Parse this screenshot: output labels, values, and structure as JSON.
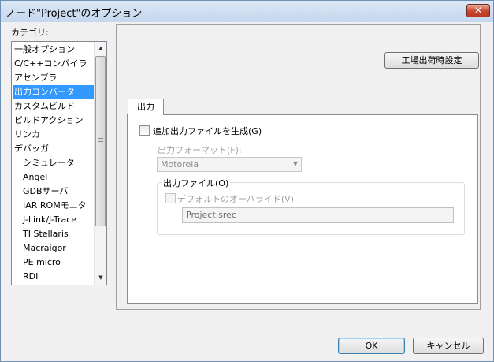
{
  "window": {
    "title": "ノード\"Project\"のオプション",
    "close_glyph": "✕"
  },
  "category": {
    "label": "カテゴリ:",
    "items": [
      {
        "label": "一般オプション",
        "level": 0,
        "selected": false
      },
      {
        "label": "C/C++コンパイラ",
        "level": 0,
        "selected": false
      },
      {
        "label": "アセンブラ",
        "level": 0,
        "selected": false
      },
      {
        "label": "出力コンバータ",
        "level": 0,
        "selected": true
      },
      {
        "label": "カスタムビルド",
        "level": 0,
        "selected": false
      },
      {
        "label": "ビルドアクション",
        "level": 0,
        "selected": false
      },
      {
        "label": "リンカ",
        "level": 0,
        "selected": false
      },
      {
        "label": "デバッガ",
        "level": 0,
        "selected": false
      },
      {
        "label": "シミュレータ",
        "level": 1,
        "selected": false
      },
      {
        "label": "Angel",
        "level": 1,
        "selected": false
      },
      {
        "label": "GDBサーバ",
        "level": 1,
        "selected": false
      },
      {
        "label": "IAR ROMモニタ",
        "level": 1,
        "selected": false
      },
      {
        "label": "J-Link/J-Trace",
        "level": 1,
        "selected": false
      },
      {
        "label": "TI Stellaris",
        "level": 1,
        "selected": false
      },
      {
        "label": "Macraigor",
        "level": 1,
        "selected": false
      },
      {
        "label": "PE micro",
        "level": 1,
        "selected": false
      },
      {
        "label": "RDI",
        "level": 1,
        "selected": false
      }
    ],
    "scroll_up_glyph": "▲",
    "scroll_down_glyph": "▼"
  },
  "panel": {
    "factory_button": "工場出荷時設定",
    "tab_label": "出力",
    "add_output": {
      "label": "追加出力ファイルを生成(G)",
      "checked": false
    },
    "format": {
      "label": "出力フォーマット(F):",
      "value": "Motorola",
      "arrow_glyph": "▼"
    },
    "output_file": {
      "group_title": "出力ファイル(O)",
      "override_label": "デフォルトのオーバライド(V)",
      "override_checked": false,
      "path": "Project.srec"
    }
  },
  "buttons": {
    "ok": "OK",
    "cancel": "キャンセル"
  }
}
